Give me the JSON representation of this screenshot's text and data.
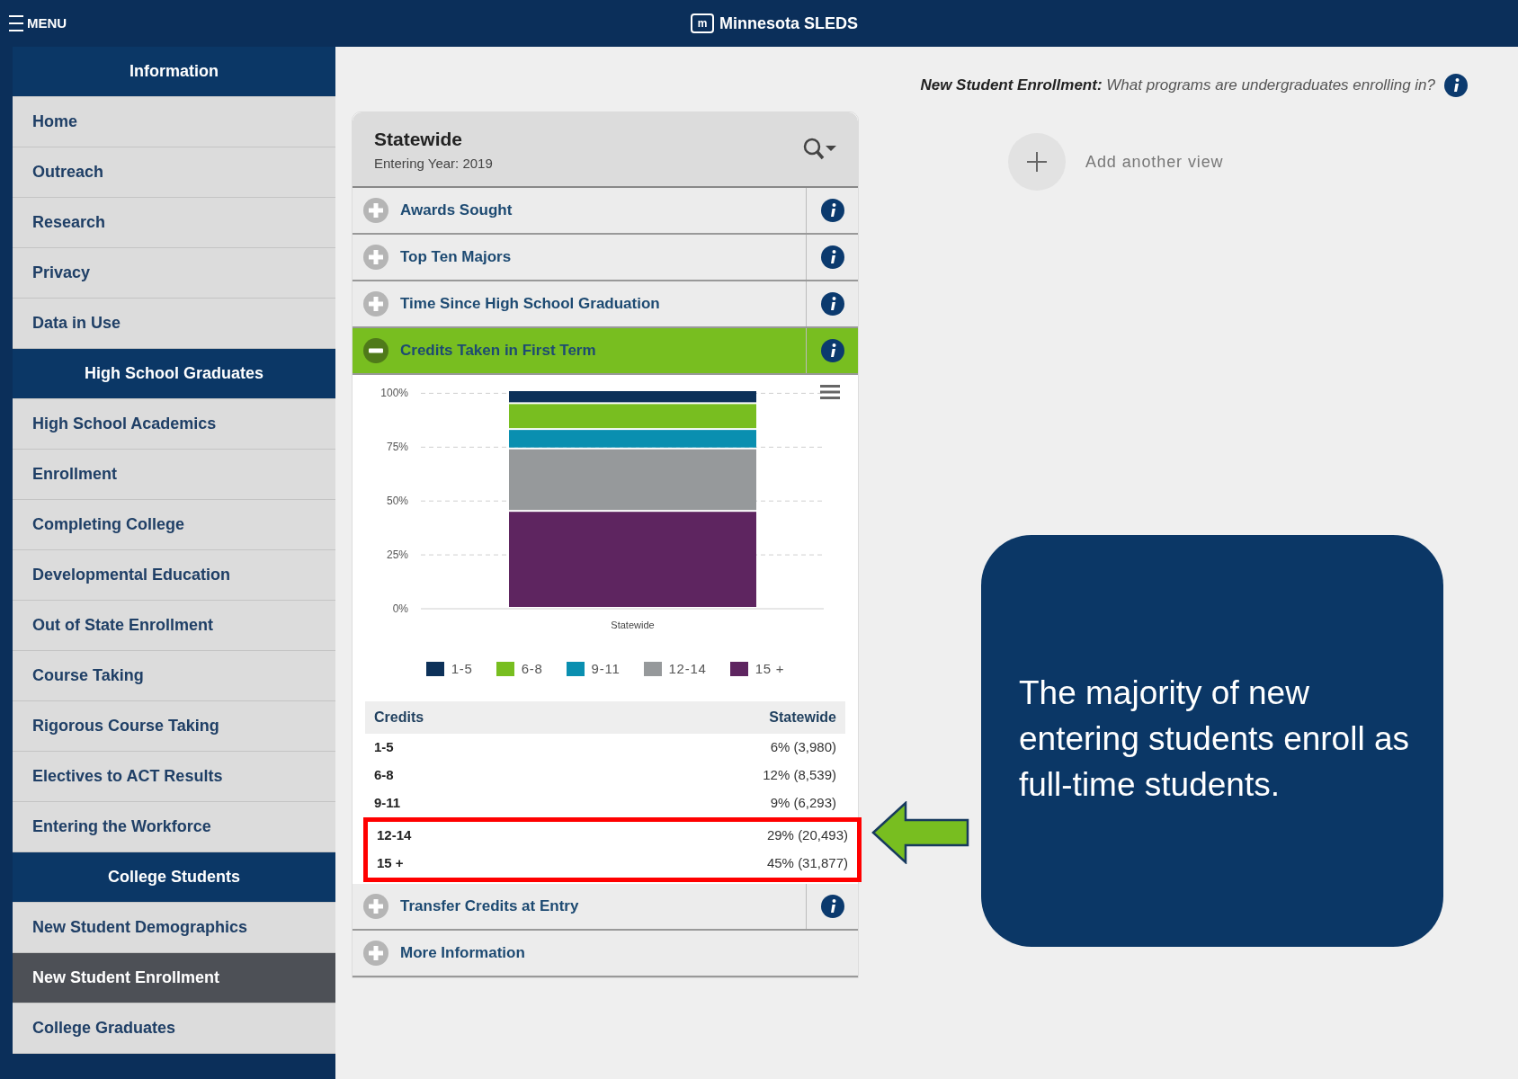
{
  "header": {
    "menu_label": "MENU",
    "logo_text": "m",
    "site_title": "Minnesota SLEDS"
  },
  "sidebar": {
    "sections": [
      {
        "title": "Information",
        "items": [
          {
            "label": "Home",
            "selected": false
          },
          {
            "label": "Outreach",
            "selected": false
          },
          {
            "label": "Research",
            "selected": false
          },
          {
            "label": "Privacy",
            "selected": false
          },
          {
            "label": "Data in Use",
            "selected": false
          }
        ]
      },
      {
        "title": "High School Graduates",
        "items": [
          {
            "label": "High School Academics",
            "selected": false
          },
          {
            "label": "Enrollment",
            "selected": false
          },
          {
            "label": "Completing College",
            "selected": false
          },
          {
            "label": "Developmental Education",
            "selected": false
          },
          {
            "label": "Out of State Enrollment",
            "selected": false
          },
          {
            "label": "Course Taking",
            "selected": false
          },
          {
            "label": "Rigorous Course Taking",
            "selected": false
          },
          {
            "label": "Electives to ACT Results",
            "selected": false
          },
          {
            "label": "Entering the Workforce",
            "selected": false
          }
        ]
      },
      {
        "title": "College Students",
        "items": [
          {
            "label": "New Student Demographics",
            "selected": false
          },
          {
            "label": "New Student Enrollment",
            "selected": true
          },
          {
            "label": "College Graduates",
            "selected": false
          }
        ]
      }
    ]
  },
  "page_heading": "**New Student Enrollment:** What programs are undergraduates enrolling in?",
  "panel": {
    "title": "Statewide",
    "subtitle": "Entering Year: 2019",
    "sections": [
      {
        "label": "Awards Sought",
        "expanded": false,
        "info": true
      },
      {
        "label": "Top Ten Majors",
        "expanded": false,
        "info": true
      },
      {
        "label": "Time Since High School Graduation",
        "expanded": false,
        "info": true
      },
      {
        "label": "Credits Taken in First Term",
        "expanded": true,
        "info": true
      },
      {
        "label": "Transfer Credits at Entry",
        "expanded": false,
        "info": true
      },
      {
        "label": "More Information",
        "expanded": false,
        "info": false
      }
    ],
    "chart_data": {
      "type": "bar",
      "stacked": true,
      "orientation": "vertical",
      "categories": [
        "Statewide"
      ],
      "ylim": [
        0,
        101
      ],
      "grid": true,
      "legend": true,
      "yticks": [
        {
          "value": 0,
          "label": "0%"
        },
        {
          "value": 25,
          "label": "25%"
        },
        {
          "value": 50,
          "label": "50%"
        },
        {
          "value": 75,
          "label": "75%"
        },
        {
          "value": 100,
          "label": "100%"
        }
      ],
      "series": [
        {
          "name": "1-5",
          "color": "#0d3159",
          "values": [
            6
          ]
        },
        {
          "name": "6-8",
          "color": "#78be20",
          "values": [
            12
          ]
        },
        {
          "name": "9-11",
          "color": "#0a8fb0",
          "values": [
            9
          ]
        },
        {
          "name": "12-14",
          "color": "#96999b",
          "values": [
            29
          ]
        },
        {
          "name": "15 +",
          "color": "#5e2560",
          "values": [
            45
          ]
        }
      ]
    },
    "table": {
      "columns": [
        "Credits",
        "Statewide"
      ],
      "rows": [
        {
          "cells": [
            "1-5",
            "6% (3,980)"
          ],
          "highlighted": false
        },
        {
          "cells": [
            "6-8",
            "12% (8,539)"
          ],
          "highlighted": false
        },
        {
          "cells": [
            "9-11",
            "9% (6,293)"
          ],
          "highlighted": false
        },
        {
          "cells": [
            "12-14",
            "29% (20,493)"
          ],
          "highlighted": true
        },
        {
          "cells": [
            "15 +",
            "45% (31,877)"
          ],
          "highlighted": true
        }
      ]
    }
  },
  "add_view": {
    "label": "Add another view"
  },
  "callout": {
    "text": "The majority of new entering students enroll as full-time students."
  }
}
